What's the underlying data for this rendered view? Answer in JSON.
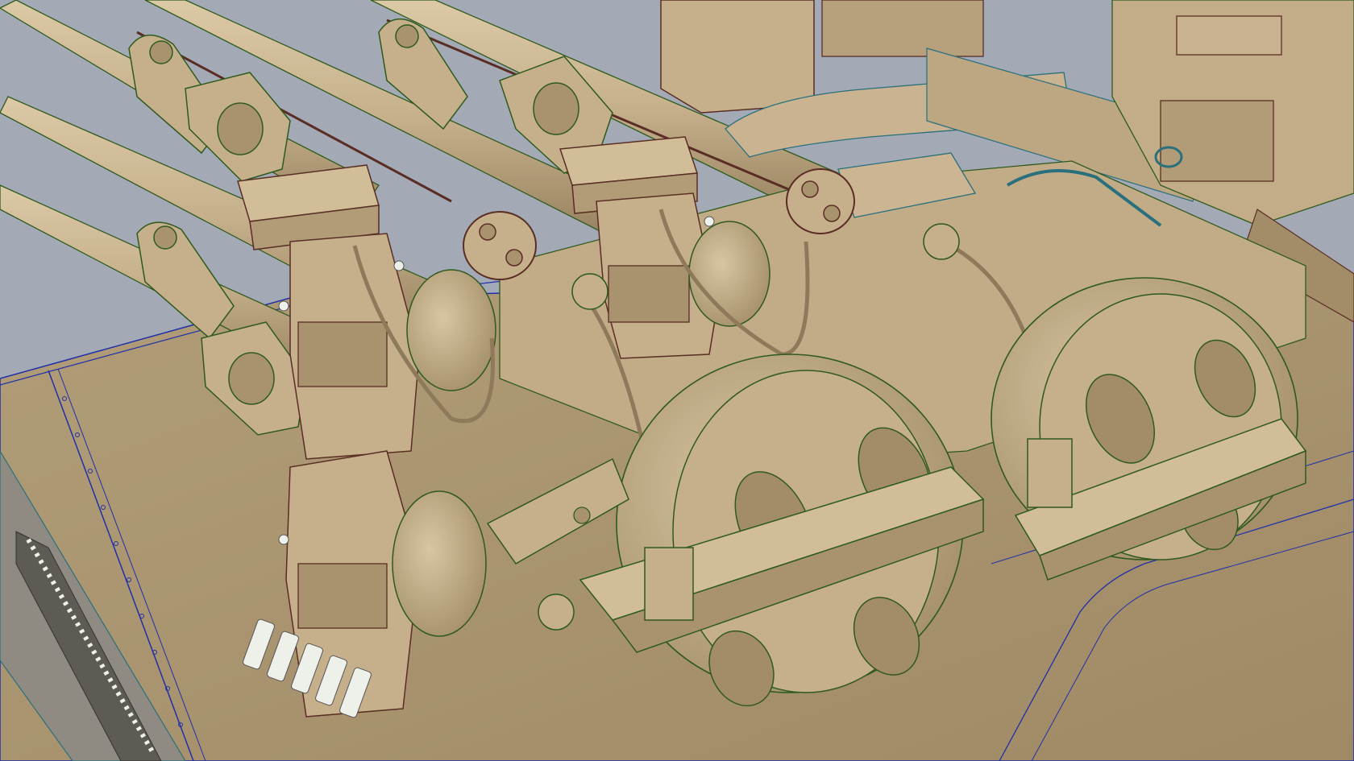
{
  "scene": {
    "kind": "cad-render",
    "subject": "",
    "colors": {
      "background": "#a3aab6",
      "body": "#c6b08c",
      "body_shade": "#a9936f",
      "body_dark": "#8e7a5a",
      "body_light": "#dcc9a6",
      "edge_green": "#2e5a1c",
      "edge_maroon": "#5a2d24",
      "edge_blue": "#1f2fa8",
      "edge_teal": "#2a6f7c",
      "rail_gray": "#6d6a63",
      "clip_white": "#eef0ea"
    }
  }
}
